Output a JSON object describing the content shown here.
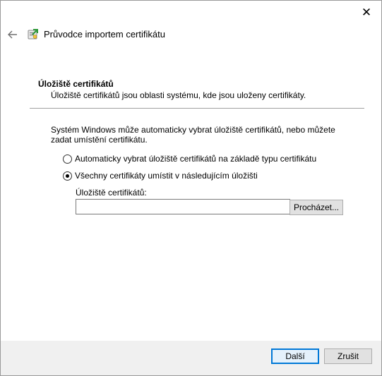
{
  "window": {
    "close_glyph": "✕",
    "back_icon": "back-arrow-icon",
    "wizard_icon": "certificate-import-icon",
    "title": "Průvodce importem certifikátu"
  },
  "section": {
    "heading": "Úložiště certifikátů",
    "description": "Úložiště certifikátů jsou oblasti systému, kde jsou uloženy certifikáty."
  },
  "intro": {
    "text": "Systém Windows může automaticky vybrat úložiště certifikátů, nebo můžete zadat umístění certifikátu."
  },
  "options": {
    "auto_label": "Automaticky vybrat úložiště certifikátů na základě typu certifikátu",
    "auto_selected": false,
    "manual_label": "Všechny certifikáty umístit v následujícím úložišti",
    "manual_selected": true
  },
  "store": {
    "label": "Úložiště certifikátů:",
    "value": "",
    "browse_label": "Procházet..."
  },
  "footer": {
    "next_label": "Další",
    "cancel_label": "Zrušit"
  },
  "colors": {
    "accent": "#0078d7",
    "footer_bg": "#f0f0f0"
  }
}
